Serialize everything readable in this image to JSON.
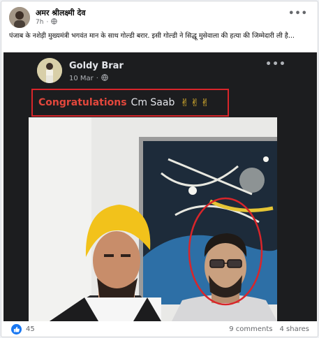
{
  "post": {
    "author": "अमर श्रीलक्ष्मी देव",
    "time": "7h",
    "dot": "·",
    "more_icon": "more-horizontal-icon",
    "privacy_icon": "globe-icon",
    "caption": "पंजाब के नशेड़ी मुख्यमंत्री भगवंत मान के साथ गोल्डी बरार. इसी गोल्डी ने सिद्धू मुसेवाला की हत्या की जिम्मेदारी ली है..."
  },
  "embedded": {
    "author": "Goldy Brar",
    "date": "10 Mar",
    "dot": "·",
    "congrats_word": "Congratulations",
    "congrats_rest": "Cm Saab",
    "emoji": "✌✌✌",
    "highlight_color": "#d9252a"
  },
  "footer": {
    "reaction_icon": "like-icon",
    "reaction_count": "45",
    "comments": "9 comments",
    "shares": "4 shares"
  },
  "colors": {
    "like_blue": "#1877f2",
    "dark_bg": "#1c1d1f"
  }
}
